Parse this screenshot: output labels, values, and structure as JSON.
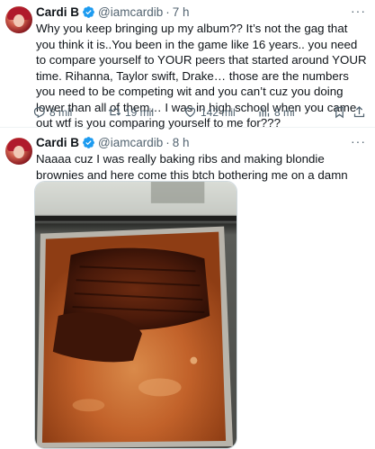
{
  "tweets": [
    {
      "author_name": "Cardi B",
      "handle": "@iamcardib",
      "separator": "·",
      "time": "7 h",
      "more": "···",
      "text": "Why you keep bringing up my album?? It’s not the gag that you think it is..You been in the game like 16 years.. you need to compare yourself to YOUR peers that started around YOUR time. Rihanna, Taylor swift, Drake… those are the numbers you need to be competing wit and you can’t cuz you doing lower than all of them… I was in high school when you came out wtf is you comparing yourself to me for???",
      "replies": "8 mil",
      "retweets": "19 mil",
      "likes": "142 mil",
      "views": "8 mi"
    },
    {
      "author_name": "Cardi B",
      "handle": "@iamcardib",
      "separator": "·",
      "time": "8 h",
      "more": "···",
      "text": "Naaaa cuz I was really baking ribs and making blondie brownies and here come this btch bothering me on a damn Monday"
    }
  ],
  "colors": {
    "verified": "#1d9bf0",
    "secondary_text": "#536471",
    "primary_text": "#0f1419"
  },
  "icons": [
    "verified-badge-icon",
    "reply-icon",
    "retweet-icon",
    "like-icon",
    "views-icon",
    "bookmark-icon",
    "share-icon"
  ]
}
